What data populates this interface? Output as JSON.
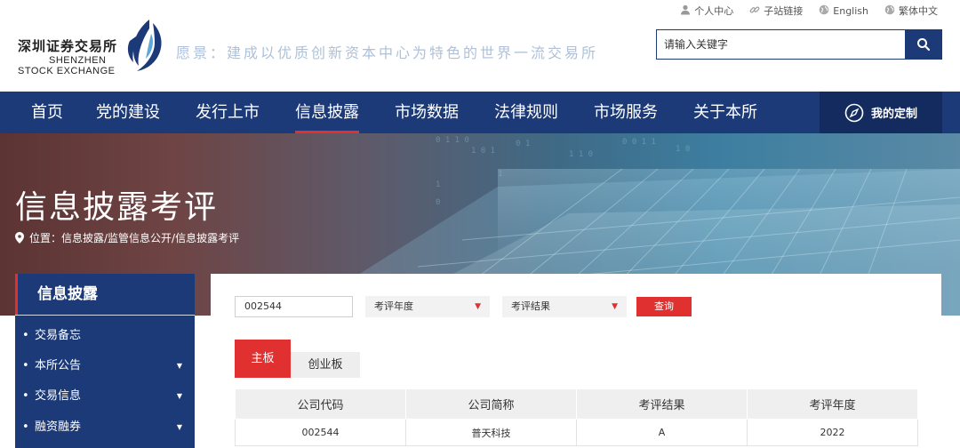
{
  "utility": {
    "personal": "个人中心",
    "sublinks": "子站链接",
    "english": "English",
    "traditional": "繁体中文"
  },
  "logo": {
    "cn": "深圳证券交易所",
    "en_line1": "SHENZHEN",
    "en_line2": "STOCK EXCHANGE"
  },
  "slogan": "愿景：建成以优质创新资本中心为特色的世界一流交易所",
  "search": {
    "placeholder": "请输入关键字"
  },
  "nav": {
    "items": [
      "首页",
      "党的建设",
      "发行上市",
      "信息披露",
      "市场数据",
      "法律规则",
      "市场服务",
      "关于本所"
    ],
    "active": "信息披露",
    "custom": "我的定制"
  },
  "banner": {
    "title": "信息披露考评",
    "breadcrumb": "位置：信息披露/监管信息公开/信息披露考评"
  },
  "sidebar": {
    "title": "信息披露",
    "items": [
      {
        "label": "交易备忘",
        "has_submenu": false
      },
      {
        "label": "本所公告",
        "has_submenu": true
      },
      {
        "label": "交易信息",
        "has_submenu": true
      },
      {
        "label": "融资融券",
        "has_submenu": true
      }
    ]
  },
  "filters": {
    "code_value": "002544",
    "year_select": "考评年度",
    "result_select": "考评结果",
    "query_button": "查询"
  },
  "tabs": [
    "主板",
    "创业板"
  ],
  "table": {
    "headers": [
      "公司代码",
      "公司简称",
      "考评结果",
      "考评年度"
    ],
    "rows": [
      [
        "002544",
        "普天科技",
        "A",
        "2022"
      ]
    ]
  },
  "colors": {
    "nav_blue": "#1c3a78",
    "accent_red": "#e0302f"
  }
}
